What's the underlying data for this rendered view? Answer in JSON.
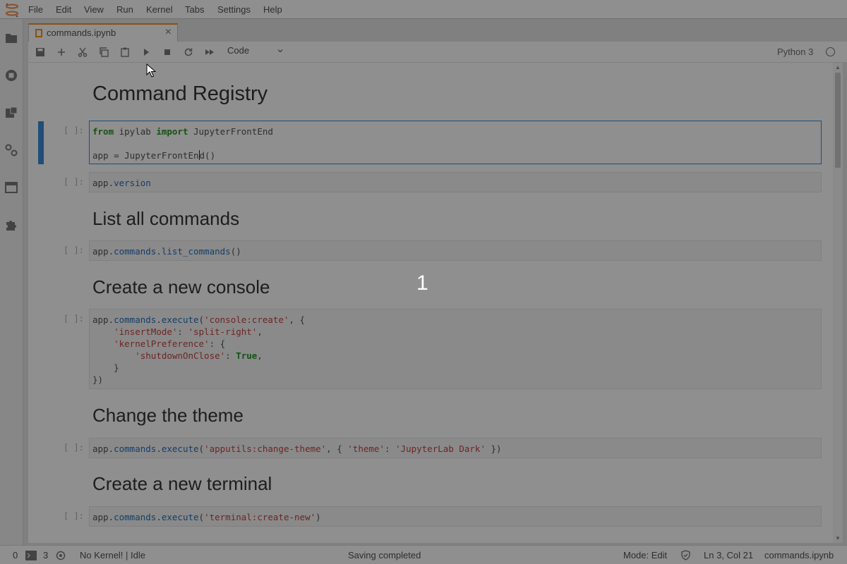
{
  "menubar": {
    "items": [
      "File",
      "Edit",
      "View",
      "Run",
      "Kernel",
      "Tabs",
      "Settings",
      "Help"
    ]
  },
  "sidebar": {
    "icons": [
      "folder-icon",
      "running-icon",
      "commands-icon",
      "property-inspector-icon",
      "tabs-icon",
      "extension-icon"
    ]
  },
  "tabs": [
    {
      "label": "commands.ipynb",
      "icon": "notebook-icon"
    }
  ],
  "toolbar": {
    "cell_type": "Code",
    "kernel_name": "Python 3"
  },
  "notebook": {
    "cells": [
      {
        "type": "markdown",
        "text": "Command Registry"
      },
      {
        "type": "code",
        "prompt": "[ ]:",
        "lines": [
          "from ipylab import JupyterFrontEnd",
          "",
          "app = JupyterFrontEnd()"
        ]
      },
      {
        "type": "code",
        "prompt": "[ ]:",
        "lines": [
          "app.version"
        ]
      },
      {
        "type": "markdown",
        "text": "List all commands"
      },
      {
        "type": "code",
        "prompt": "[ ]:",
        "lines": [
          "app.commands.list_commands()"
        ]
      },
      {
        "type": "markdown",
        "text": "Create a new console"
      },
      {
        "type": "code",
        "prompt": "[ ]:",
        "lines": [
          "app.commands.execute('console:create', {",
          "    'insertMode': 'split-right',",
          "    'kernelPreference': {",
          "        'shutdownOnClose': True,",
          "    }",
          "})"
        ]
      },
      {
        "type": "markdown",
        "text": "Change the theme"
      },
      {
        "type": "code",
        "prompt": "[ ]:",
        "lines": [
          "app.commands.execute('apputils:change-theme', { 'theme': 'JupyterLab Dark' })"
        ]
      },
      {
        "type": "markdown",
        "text": "Create a new terminal"
      },
      {
        "type": "code",
        "prompt": "[ ]:",
        "lines": [
          "app.commands.execute('terminal:create-new')"
        ]
      }
    ]
  },
  "overlay": {
    "number": "1"
  },
  "statusbar": {
    "terminals_count": "0",
    "kernels_count": "3",
    "kernel_status": "No Kernel! | Idle",
    "message": "Saving completed",
    "mode": "Mode: Edit",
    "position": "Ln 3, Col 21",
    "filename": "commands.ipynb"
  }
}
